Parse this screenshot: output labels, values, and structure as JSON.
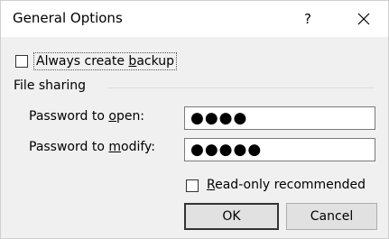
{
  "window": {
    "title": "General Options",
    "help_label": "?",
    "close_icon": "close-icon"
  },
  "backup": {
    "label_prefix": "Always create ",
    "label_accel": "b",
    "label_suffix": "ackup",
    "checked": false
  },
  "file_sharing": {
    "section_label": "File sharing",
    "open": {
      "label_prefix": "Password to ",
      "label_accel": "o",
      "label_suffix": "pen:",
      "value": "●●●●"
    },
    "modify": {
      "label_prefix": "Password to ",
      "label_accel": "m",
      "label_suffix": "odify:",
      "value": "●●●●●"
    }
  },
  "read_only": {
    "label_accel": "R",
    "label_suffix": "ead-only recommended",
    "checked": false
  },
  "buttons": {
    "ok": "OK",
    "cancel": "Cancel"
  }
}
